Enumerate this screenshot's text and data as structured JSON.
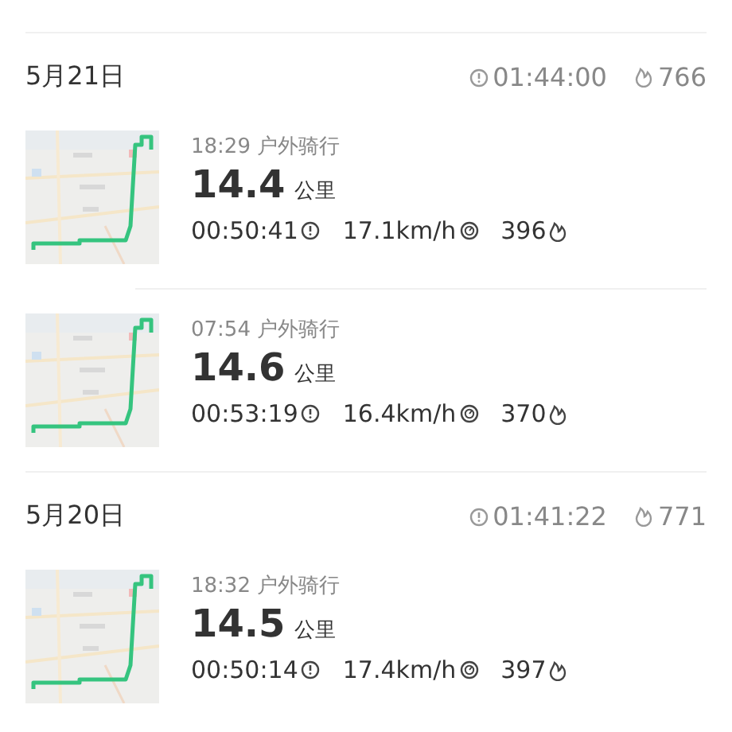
{
  "days": [
    {
      "date": "5月21日",
      "duration": "01:44:00",
      "calories": "766",
      "activities": [
        {
          "time": "18:29",
          "type": "户外骑行",
          "distance": "14.4",
          "unit": "公里",
          "duration": "00:50:41",
          "speed": "17.1km/h",
          "calories": "396"
        },
        {
          "time": "07:54",
          "type": "户外骑行",
          "distance": "14.6",
          "unit": "公里",
          "duration": "00:53:19",
          "speed": "16.4km/h",
          "calories": "370"
        }
      ]
    },
    {
      "date": "5月20日",
      "duration": "01:41:22",
      "calories": "771",
      "activities": [
        {
          "time": "18:32",
          "type": "户外骑行",
          "distance": "14.5",
          "unit": "公里",
          "duration": "00:50:14",
          "speed": "17.4km/h",
          "calories": "397"
        }
      ]
    }
  ]
}
